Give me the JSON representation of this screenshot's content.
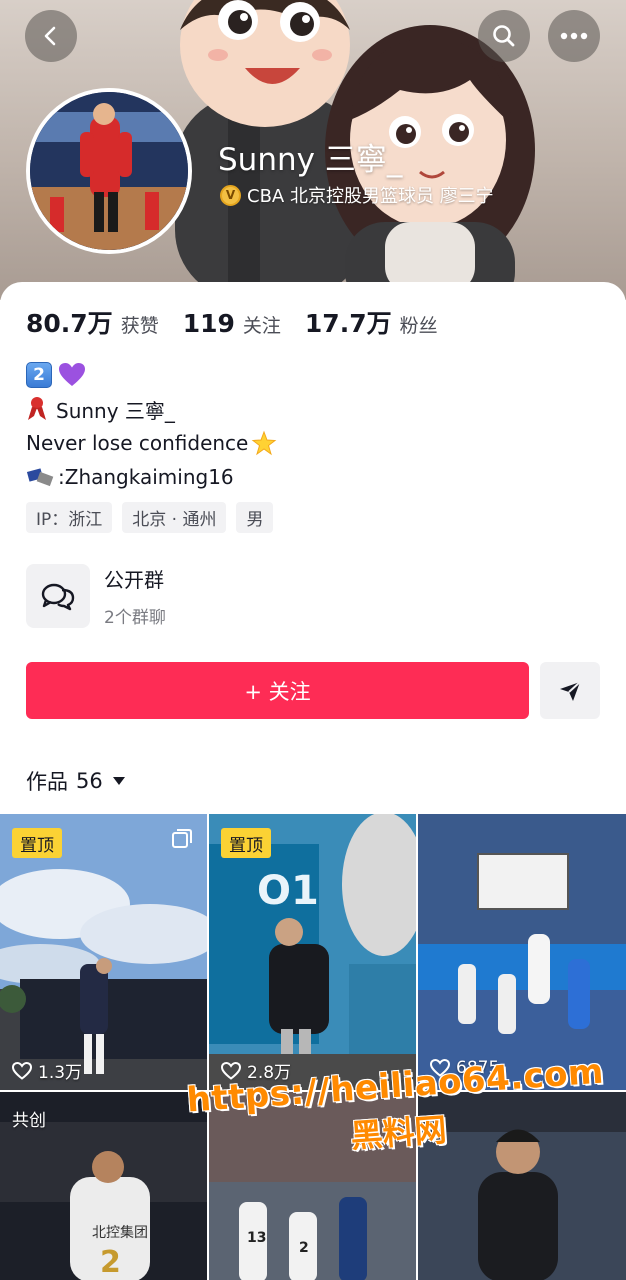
{
  "header": {
    "nickname": "Sunny 三寧_",
    "verification": "CBA 北京控股男篮球员 廖三宁",
    "verify_badge": "V",
    "icons": [
      "back-icon",
      "search-icon",
      "more-icon"
    ]
  },
  "stats": [
    {
      "value": "80.7万",
      "label": "获赞"
    },
    {
      "value": "119",
      "label": "关注"
    },
    {
      "value": "17.7万",
      "label": "粉丝"
    }
  ],
  "bio": {
    "line1_number": "2",
    "line2": "Sunny 三寧_",
    "line3": "Never lose confidence",
    "line4": ":Zhangkaiming16"
  },
  "tags": [
    "IP：浙江",
    "北京 · 通州",
    "男"
  ],
  "group": {
    "title": "公开群",
    "subtitle": "2个群聊"
  },
  "actions": {
    "follow_label": "+ 关注"
  },
  "works": {
    "label": "作品",
    "count": "56"
  },
  "grid": [
    {
      "badge": "置顶",
      "likes": "1.3万"
    },
    {
      "badge": "置顶",
      "likes": "2.8万"
    },
    {
      "badge": "",
      "likes": "6875"
    },
    {
      "badge": "共创",
      "likes": ""
    },
    {
      "badge": "",
      "likes": ""
    },
    {
      "badge": "",
      "likes": ""
    }
  ],
  "watermark": {
    "url": "https://heiliao64.com",
    "name": "黑料网"
  },
  "colors": {
    "accent": "#fe2c55",
    "pin": "#fbd234",
    "watermark": "#ff8a00"
  }
}
